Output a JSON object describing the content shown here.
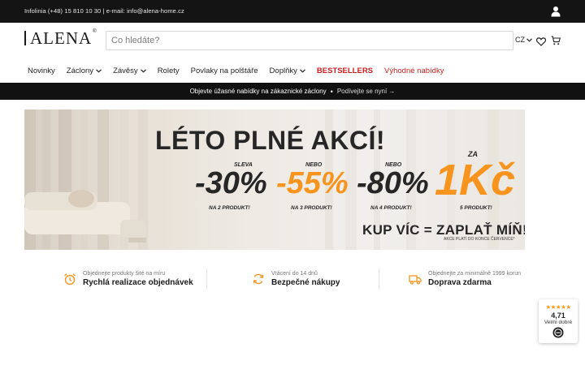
{
  "topbar": {
    "contact": "Infolinia (+48) 15 810 10 30 | e-mail: info@alena-home.cz",
    "user_icon": "user-icon"
  },
  "header": {
    "logo_text": "ALENA",
    "logo_mark": "®",
    "search": {
      "placeholder": "Co hledáte?",
      "value": ""
    },
    "language": "CZ",
    "icons": [
      "chevron-down-icon",
      "heart-icon",
      "cart-icon"
    ]
  },
  "nav": {
    "items": [
      {
        "label": "Novinky",
        "dropdown": false
      },
      {
        "label": "Záclony",
        "dropdown": true
      },
      {
        "label": "Závěsy",
        "dropdown": true
      },
      {
        "label": "Rolety",
        "dropdown": false
      },
      {
        "label": "Povlaky na polštáře",
        "dropdown": false
      },
      {
        "label": "Doplňky",
        "dropdown": true
      },
      {
        "label": "BESTSELLERS",
        "dropdown": false
      },
      {
        "label": "Výhodné nabídky",
        "dropdown": false
      }
    ]
  },
  "strip": {
    "text": "Objevte úžasné nabídky na zákaznické záclony",
    "separator": "•",
    "link": "Podívejte se nyní →"
  },
  "hero": {
    "title": "LÉTO PLNÉ AKCÍ!",
    "offers": [
      {
        "top": "SLEVA",
        "value": "-30%",
        "bottom": "NA 2 PRODUKT!"
      },
      {
        "top": "NEBO",
        "value": "-55%",
        "bottom": "NA 3 PRODUKT!"
      },
      {
        "top": "NEBO",
        "value": "-80%",
        "bottom": "NA 4 PRODUKT!"
      },
      {
        "top": "ZA",
        "value": "1Kč",
        "bottom": "5 PRODUKT!"
      }
    ],
    "slogan": "KUP VÍC = ZAPLAŤ MÍŇ!",
    "note": "AKCE PLATÍ DO KONCE ČERVENCE*",
    "colors": {
      "dark": "#262626",
      "orange": "#f7941d"
    }
  },
  "benefits": [
    {
      "sub": "Objednejte produkty šité na míru",
      "main": "Rychlá realizace objednávek",
      "icon": "alarm-clock-icon"
    },
    {
      "sub": "Vrácení do 14 dnů",
      "main": "Bezpečné nákupy",
      "icon": "refresh-icon"
    },
    {
      "sub": "Objednejte za minimálně 1999 korun",
      "main": "Doprava zdarma",
      "icon": "delivery-truck-icon"
    }
  ],
  "rating": {
    "stars": "★★★★★",
    "score": "4,71",
    "label": "Velmi dobré",
    "badge_icon": "trusted-shops-badge-icon"
  },
  "colors": {
    "accent_orange": "#f7941d",
    "sale_red": "#c81e1e",
    "topbar_bg": "#141414"
  }
}
